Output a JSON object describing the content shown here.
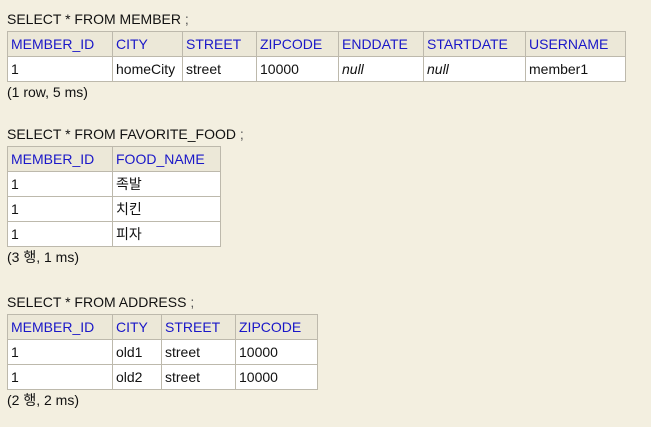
{
  "results": [
    {
      "query": "SELECT * FROM MEMBER",
      "terminator": ";",
      "columns": [
        "MEMBER_ID",
        "CITY",
        "STREET",
        "ZIPCODE",
        "ENDDATE",
        "STARTDATE",
        "USERNAME"
      ],
      "col_widths": [
        105,
        70,
        74,
        82,
        85,
        102,
        100
      ],
      "rows": [
        [
          "1",
          "homeCity",
          "street",
          "10000",
          "null",
          "null",
          "member1"
        ]
      ],
      "null_cells": [
        [
          0,
          4
        ],
        [
          0,
          5
        ]
      ],
      "summary": "(1 row, 5 ms)"
    },
    {
      "query": "SELECT * FROM FAVORITE_FOOD",
      "terminator": ";",
      "columns": [
        "MEMBER_ID",
        "FOOD_NAME"
      ],
      "col_widths": [
        105,
        108
      ],
      "rows": [
        [
          "1",
          "족발"
        ],
        [
          "1",
          "치킨"
        ],
        [
          "1",
          "피자"
        ]
      ],
      "null_cells": [],
      "summary": "(3 행, 1 ms)"
    },
    {
      "query": "SELECT * FROM ADDRESS",
      "terminator": ";",
      "columns": [
        "MEMBER_ID",
        "CITY",
        "STREET",
        "ZIPCODE"
      ],
      "col_widths": [
        105,
        49,
        74,
        82
      ],
      "rows": [
        [
          "1",
          "old1",
          "street",
          "10000"
        ],
        [
          "1",
          "old2",
          "street",
          "10000"
        ]
      ],
      "null_cells": [],
      "summary": "(2 행, 2 ms)"
    }
  ]
}
